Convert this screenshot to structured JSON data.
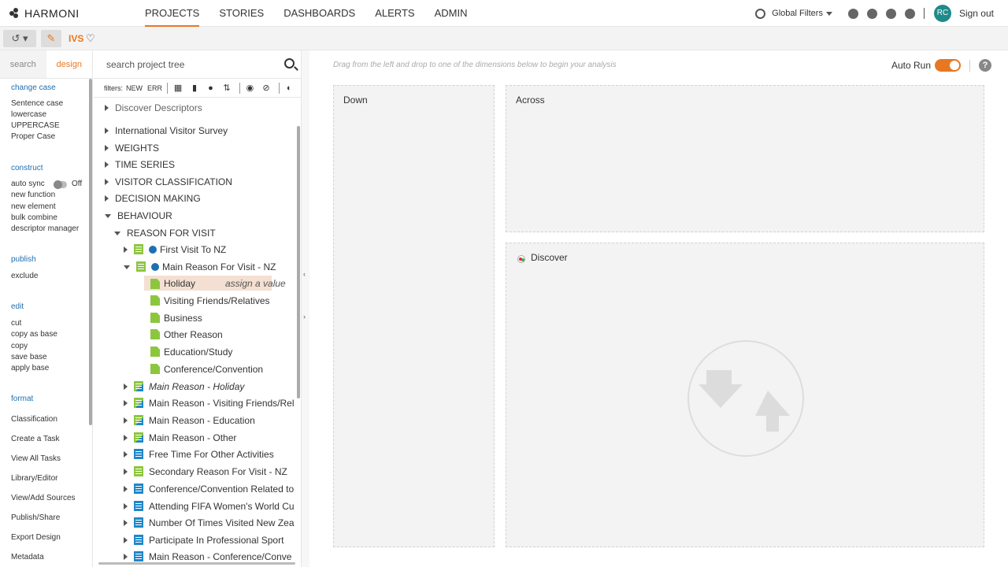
{
  "brand": {
    "name": "HARMONI"
  },
  "nav": {
    "links": [
      "PROJECTS",
      "STORIES",
      "DASHBOARDS",
      "ALERTS",
      "ADMIN"
    ],
    "global_filters": "Global Filters",
    "avatar": "RC",
    "signout": "Sign out"
  },
  "subbar": {
    "project": "IVS"
  },
  "leftmenu": {
    "tabs": [
      "search",
      "design"
    ],
    "sections": {
      "change_case": {
        "title": "change case",
        "items": [
          "Sentence case",
          "lowercase",
          "UPPERCASE",
          "Proper Case"
        ]
      },
      "construct": {
        "title": "construct",
        "auto_sync_label": "auto sync",
        "auto_sync_state": "Off",
        "items": [
          "new function",
          "new element",
          "bulk combine",
          "descriptor manager"
        ]
      },
      "publish": {
        "title": "publish",
        "items": [
          "exclude"
        ]
      },
      "edit": {
        "title": "edit",
        "items": [
          "cut",
          "copy as base",
          "copy",
          "save base",
          "apply base"
        ]
      },
      "format": {
        "title": "format",
        "items": [
          "Classification",
          "Create a Task",
          "View All Tasks",
          "Library/Editor",
          "View/Add Sources",
          "Publish/Share",
          "Export Design",
          "Metadata"
        ]
      }
    }
  },
  "tree": {
    "search_placeholder": "search project tree",
    "filters_label": "filters:",
    "filter_new": "NEW",
    "filter_err": "ERR",
    "nodes": [
      "Discover Descriptors",
      "International Visitor Survey",
      "WEIGHTS",
      "TIME SERIES",
      "VISITOR CLASSIFICATION",
      "DECISION MAKING",
      "BEHAVIOUR",
      "REASON FOR VISIT",
      "First Visit To NZ",
      "Main Reason For Visit - NZ",
      "Holiday",
      "Visiting Friends/Relatives",
      "Business",
      "Other Reason",
      "Education/Study",
      "Conference/Convention",
      "Main Reason - Holiday",
      "Main Reason - Visiting Friends/Rel",
      "Main Reason - Education",
      "Main Reason - Other",
      "Free Time For Other Activities",
      "Secondary Reason For Visit - NZ",
      "Conference/Convention Related to",
      "Attending FIFA Women's World Cu",
      "Number Of Times Visited New Zea",
      "Participate In Professional Sport",
      "Main Reason - Conference/Conve"
    ],
    "assign_value": "assign a value"
  },
  "main": {
    "hint": "Drag from the left and drop to one of the dimensions below to begin your analysis",
    "auto_run": "Auto Run",
    "help": "?",
    "zones": {
      "down": "Down",
      "across": "Across",
      "discover": "Discover"
    }
  },
  "colors": {
    "accent": "#e87722",
    "link": "#1f6fb0",
    "teal": "#1f8a8a"
  }
}
